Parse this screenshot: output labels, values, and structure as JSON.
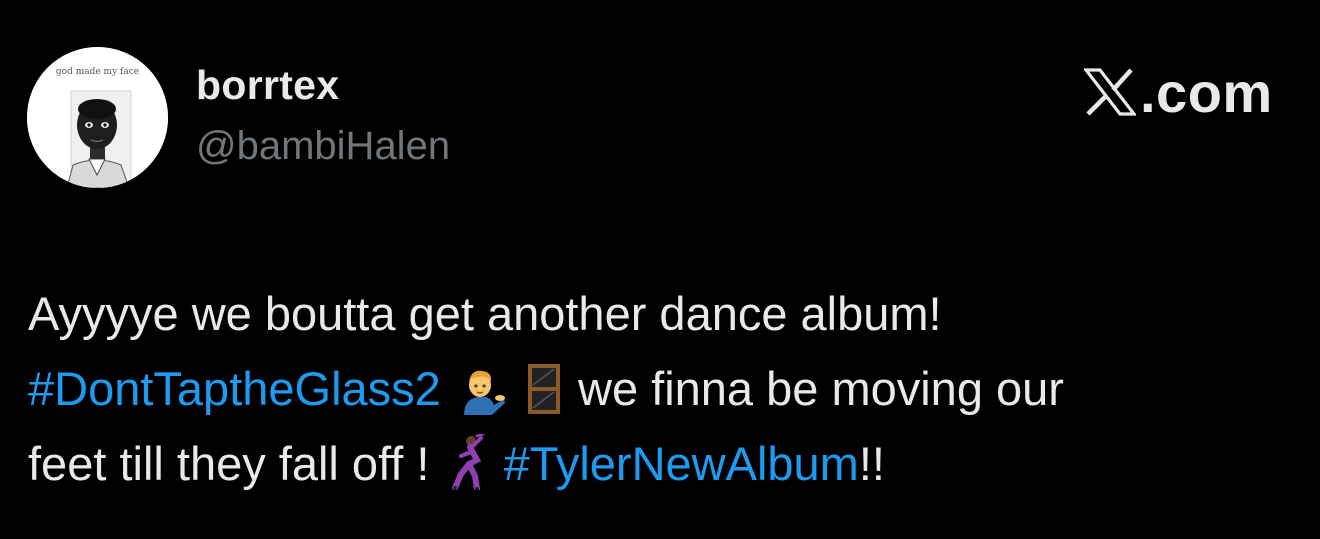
{
  "user": {
    "avatar_caption": "god made my face",
    "display_name": "borrtex",
    "handle": "@bambiHalen"
  },
  "brand": {
    "logo_text": ".com",
    "logo_icon": "x-logo-icon"
  },
  "tweet": {
    "line1": "Ayyyye we boutta get another dance album!",
    "hashtag1": "#DontTaptheGlass2",
    "emoji1": "man-tipping-hand-emoji",
    "emoji2": "window-emoji",
    "line2_rest": "we finna be moving our",
    "line3_start": "feet till they fall off !",
    "emoji3": "man-dancing-emoji",
    "hashtag2": "#TylerNewAlbum",
    "line3_end": "!!"
  },
  "colors": {
    "background": "#000000",
    "text": "#e7e9ea",
    "muted": "#71767b",
    "link": "#1d9bf0"
  }
}
